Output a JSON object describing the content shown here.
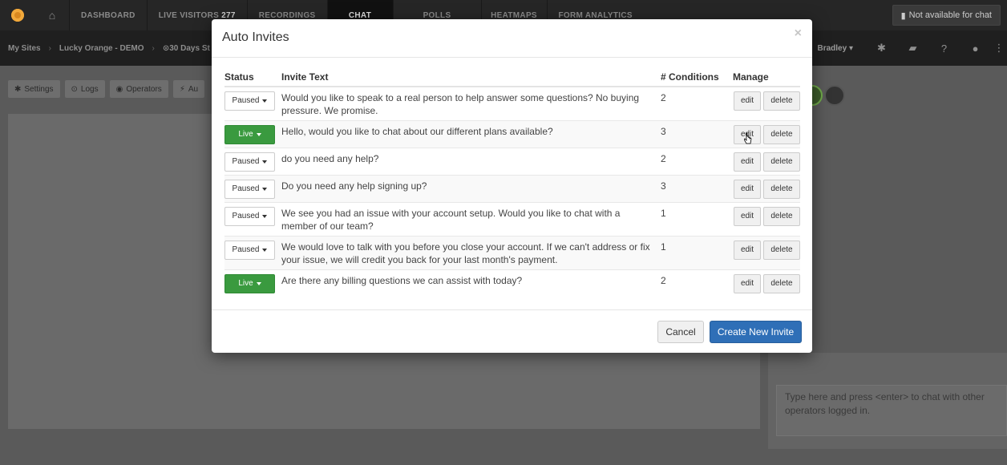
{
  "topnav": {
    "tabs": [
      {
        "label": "DASHBOARD"
      },
      {
        "label": "LIVE VISITORS",
        "count": "277"
      },
      {
        "label": "RECORDINGS"
      },
      {
        "label": "CHAT"
      },
      {
        "label": "POLLS"
      },
      {
        "label": "HEATMAPS"
      },
      {
        "label": "FORM ANALYTICS"
      }
    ],
    "availability_label": "Not available for chat"
  },
  "subnav": {
    "crumbs": [
      "My Sites",
      "Lucky Orange - DEMO",
      "30 Days St"
    ],
    "user": "Bradley"
  },
  "toolbar": {
    "settings": "Settings",
    "logs": "Logs",
    "operators": "Operators",
    "auto": "Au"
  },
  "chat_input": {
    "placeholder": "Type here and press <enter> to chat with other operators logged in."
  },
  "modal": {
    "title": "Auto Invites",
    "close": "×",
    "columns": {
      "status": "Status",
      "invite_text": "Invite Text",
      "conditions": "# Conditions",
      "manage": "Manage"
    },
    "rows": [
      {
        "status": "Paused",
        "text": "Would you like to speak to a real person to help answer some questions? No buying pressure. We promise.",
        "conditions": "2"
      },
      {
        "status": "Live",
        "text": "Hello, would you like to chat about our different plans available?",
        "conditions": "3"
      },
      {
        "status": "Paused",
        "text": "do you need any help?",
        "conditions": "2"
      },
      {
        "status": "Paused",
        "text": "Do you need any help signing up?",
        "conditions": "3"
      },
      {
        "status": "Paused",
        "text": "We see you had an issue with your account setup. Would you like to chat with a member of our team?",
        "conditions": "1"
      },
      {
        "status": "Paused",
        "text": "We would love to talk with you before you close your account. If we can't address or fix your issue, we will credit you back for your last month's payment.",
        "conditions": "1"
      },
      {
        "status": "Live",
        "text": "Are there any billing questions we can assist with today?",
        "conditions": "2"
      }
    ],
    "edit_label": "edit",
    "delete_label": "delete",
    "cancel_label": "Cancel",
    "create_label": "Create New Invite"
  },
  "colors": {
    "live": "#3a9a3f",
    "primary": "#2f6fb7",
    "nav_bg": "#262626"
  }
}
